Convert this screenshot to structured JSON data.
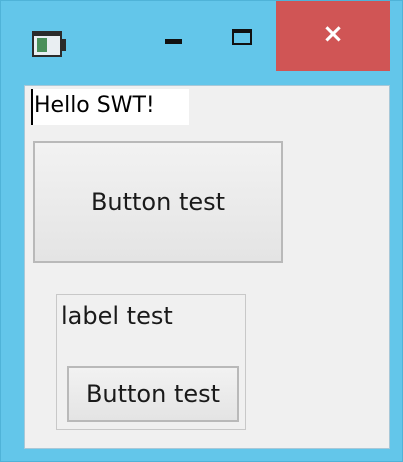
{
  "title_bar": {
    "app_icon": "app-window-icon",
    "minimize_icon": "minimize-icon",
    "maximize_icon": "maximize-icon",
    "close_icon": "close-icon",
    "close_glyph": "×",
    "close_color": "#d05555",
    "frame_color": "#63c6ea"
  },
  "content": {
    "text_field_value": "Hello SWT!",
    "button_large_label": "Button test",
    "group_label": "label test",
    "button_small_label": "Button test"
  }
}
